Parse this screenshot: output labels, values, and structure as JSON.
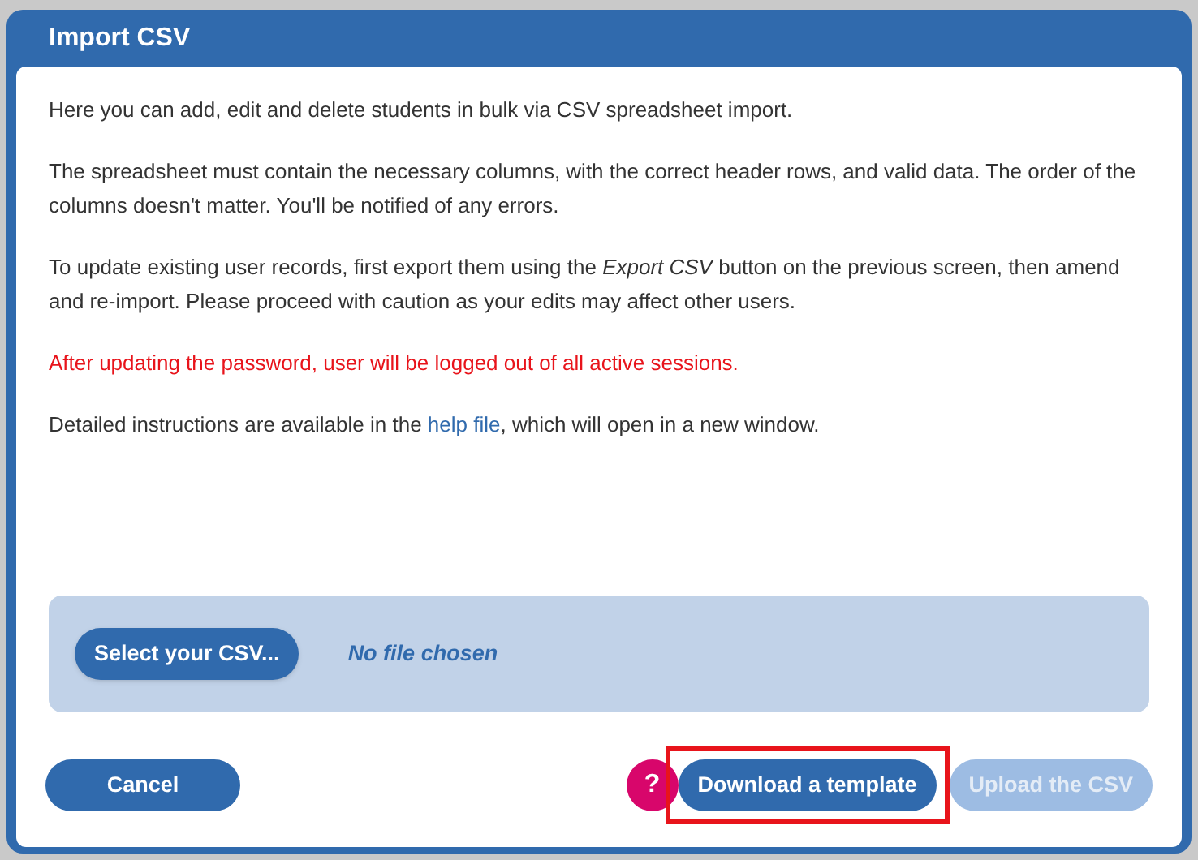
{
  "dialog": {
    "title": "Import CSV",
    "paragraphs": [
      {
        "kind": "normal",
        "text": "Here you can add, edit and delete students in bulk via CSV spreadsheet import."
      },
      {
        "kind": "normal",
        "text": "The spreadsheet must contain the necessary columns, with the correct header rows, and valid data. The order of the columns doesn't matter. You'll be notified of any errors."
      },
      {
        "kind": "normal",
        "text": "To update existing user records, first export them using the *Export CSV* button on the previous screen, then amend and re-import. Please proceed with caution as your edits may affect other users."
      },
      {
        "kind": "warning",
        "text": "After updating the password, user will be logged out of all active sessions."
      },
      {
        "kind": "link",
        "before": "Detailed instructions are available in the ",
        "link": "help file",
        "after": ", which will open in a new window."
      }
    ],
    "file_picker": {
      "button": "Select your CSV...",
      "status": "No file chosen"
    },
    "buttons": [
      {
        "kind": "cancel",
        "label": "Cancel",
        "disabled": false,
        "highlighted": false
      },
      {
        "kind": "help",
        "label": "?",
        "disabled": false,
        "highlighted": false
      },
      {
        "kind": "primary",
        "label": "Download a template",
        "disabled": false,
        "highlighted": true
      },
      {
        "kind": "primary",
        "label": "Upload the CSV",
        "disabled": true,
        "highlighted": false
      }
    ]
  }
}
